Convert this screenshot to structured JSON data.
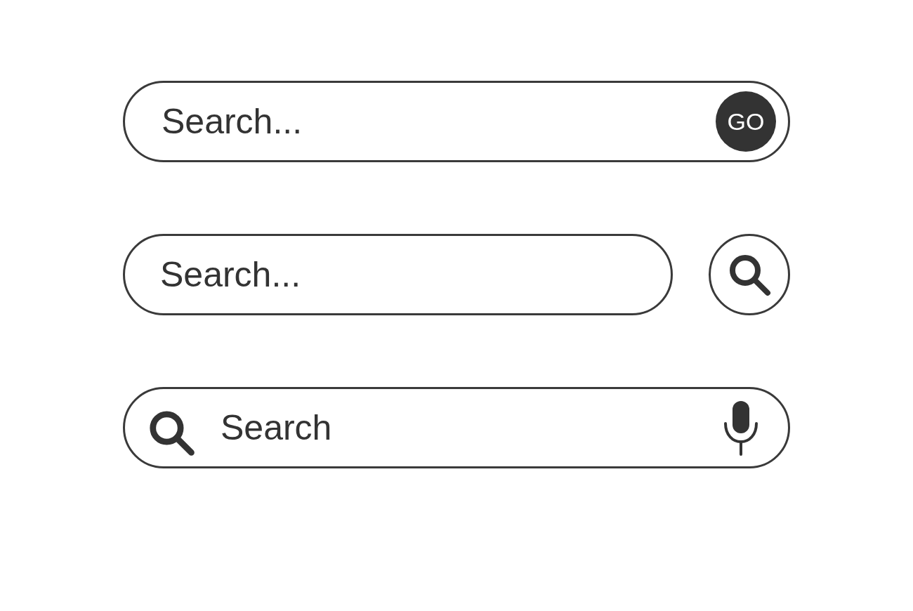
{
  "search_bars": [
    {
      "kind": "go",
      "placeholder": "Search...",
      "button": "GO"
    },
    {
      "kind": "separate",
      "placeholder": "Search..."
    },
    {
      "kind": "voice",
      "placeholder": "Search"
    }
  ]
}
